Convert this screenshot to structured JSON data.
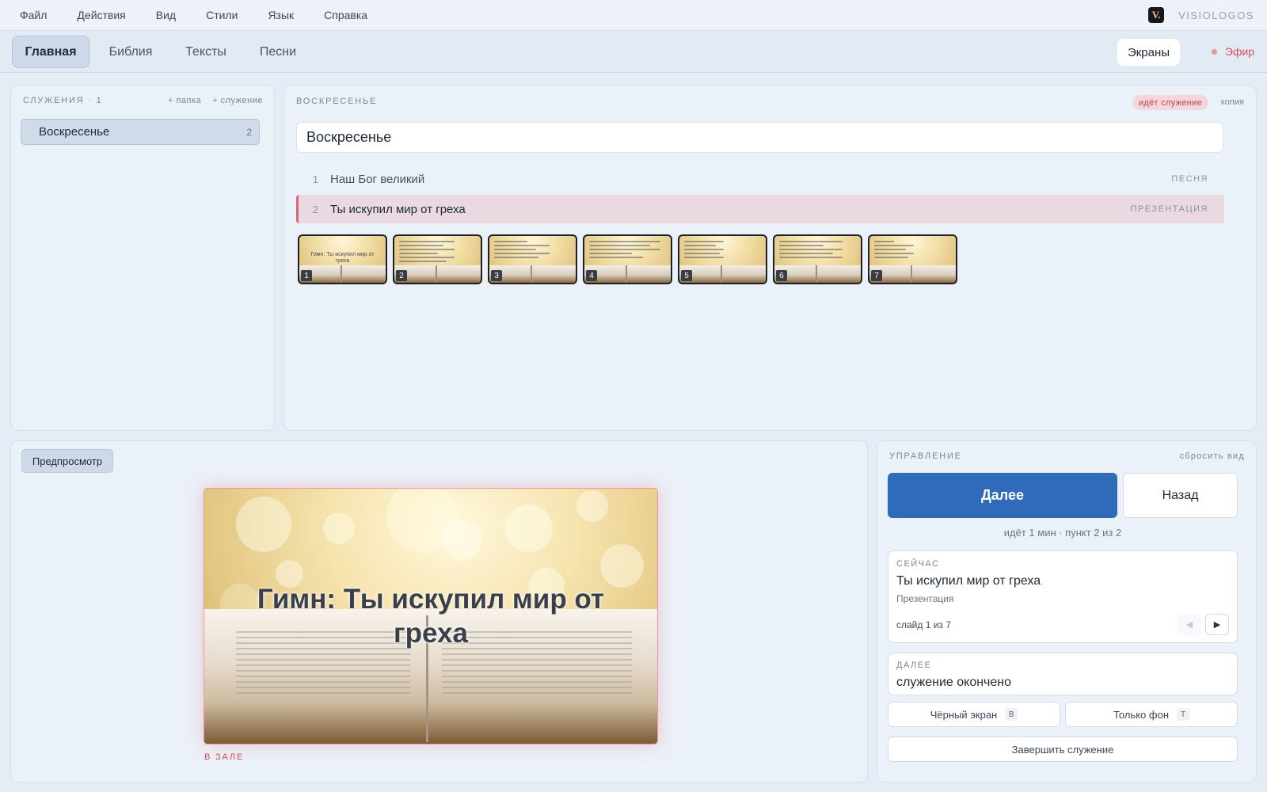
{
  "menu": {
    "items": [
      "Файл",
      "Действия",
      "Вид",
      "Стили",
      "Язык",
      "Справка"
    ],
    "brand_logo": "V.",
    "brand_name": "VISIOLOGOS"
  },
  "tabs": {
    "items": [
      "Главная",
      "Библия",
      "Тексты",
      "Песни"
    ],
    "active": "Главная",
    "screens_label": "Экраны",
    "air_label": "Эфир"
  },
  "services": {
    "header": "СЛУЖЕНИЯ · 1",
    "add_folder": "+ папка",
    "add_service": "+ служение",
    "items": [
      {
        "name": "Воскресенье",
        "count": "2"
      }
    ]
  },
  "service": {
    "header": "ВОСКРЕСЕНЬЕ",
    "live_badge": "идёт служение",
    "copy_label": "копия",
    "title_value": "Воскресенье",
    "items": [
      {
        "num": "1",
        "title": "Наш Бог великий",
        "type": "ПЕСНЯ"
      },
      {
        "num": "2",
        "title": "Ты искупил мир от греха",
        "type": "ПРЕЗЕНТАЦИЯ"
      }
    ],
    "slides": [
      {
        "num": "1",
        "title": "Гимн: Ты искупил мир от греха"
      },
      {
        "num": "2"
      },
      {
        "num": "3"
      },
      {
        "num": "4"
      },
      {
        "num": "5"
      },
      {
        "num": "6"
      },
      {
        "num": "7"
      }
    ]
  },
  "preview": {
    "button_label": "Предпросмотр",
    "slide_title": "Гимн: Ты искупил мир от греха",
    "in_hall_label": "В ЗАЛЕ"
  },
  "control": {
    "header": "УПРАВЛЕНИЕ",
    "reset_label": "сбросить вид",
    "next_label": "Далее",
    "back_label": "Назад",
    "status": "идёт 1 мин · пункт 2 из 2",
    "now": {
      "label": "СЕЙЧАС",
      "title": "Ты искупил мир от греха",
      "type": "Презентация",
      "slide": "слайд 1 из 7"
    },
    "next": {
      "label": "ДАЛЕЕ",
      "title": "служение окончено"
    },
    "black_screen": {
      "label": "Чёрный экран",
      "key": "B"
    },
    "bg_only": {
      "label": "Только фон",
      "key": "T"
    },
    "finish_label": "Завершить служение"
  },
  "colors": {
    "accent": "#2f6bb8",
    "live": "#d3545a",
    "current_item_bg": "#ead9e0"
  },
  "icons": {
    "air_indicator": "record-dot-icon",
    "prev": "triangle-left-icon",
    "next": "triangle-right-icon"
  }
}
